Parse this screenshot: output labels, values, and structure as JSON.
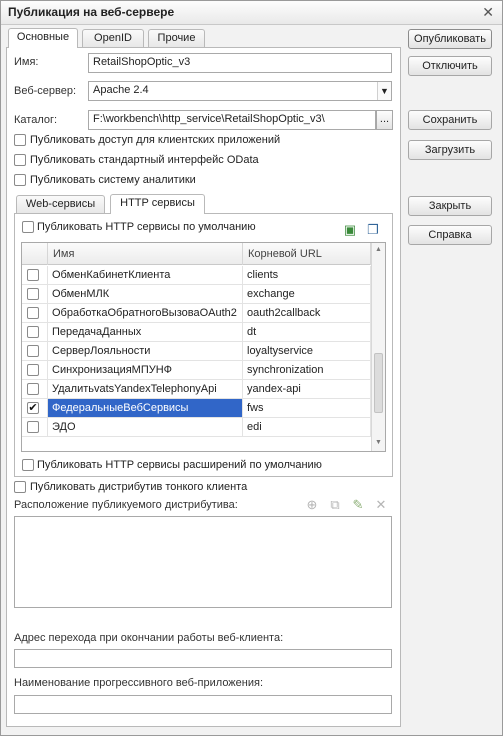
{
  "window": {
    "title": "Публикация на веб-сервере"
  },
  "tabs": [
    {
      "label": "Основные"
    },
    {
      "label": "OpenID"
    },
    {
      "label": "Прочие"
    }
  ],
  "form": {
    "name_label": "Имя:",
    "name_value": "RetailShopOptic_v3",
    "webserver_label": "Веб-сервер:",
    "webserver_value": "Apache 2.4",
    "catalog_label": "Каталог:",
    "catalog_value": "F:\\workbench\\http_service\\RetailShopOptic_v3\\",
    "catalog_button": "...",
    "checks": [
      {
        "label": "Публиковать доступ для клиентских приложений",
        "checked": false
      },
      {
        "label": "Публиковать стандартный интерфейс OData",
        "checked": false
      },
      {
        "label": "Публиковать систему аналитики",
        "checked": false
      }
    ]
  },
  "subtabs": [
    {
      "label": "Web-сервисы"
    },
    {
      "label": "HTTP сервисы"
    }
  ],
  "http": {
    "publish_default_label": "Публиковать HTTP сервисы по умолчанию",
    "col_name": "Имя",
    "col_url": "Корневой URL",
    "rows": [
      {
        "name": "ОбменКабинетКлиента",
        "url": "clients",
        "checked": false
      },
      {
        "name": "ОбменМЛК",
        "url": "exchange",
        "checked": false
      },
      {
        "name": "ОбработкаОбратногоВызоваOAuth2",
        "url": "oauth2callback",
        "checked": false
      },
      {
        "name": "ПередачаДанных",
        "url": "dt",
        "checked": false
      },
      {
        "name": "СерверЛояльности",
        "url": "loyaltyservice",
        "checked": false
      },
      {
        "name": "СинхронизацияМПУНФ",
        "url": "synchronization",
        "checked": false
      },
      {
        "name": "УдалитьvatsYandexTelephonyApi",
        "url": "yandex-api",
        "checked": false
      },
      {
        "name": "ФедеральныеВебСервисы",
        "url": "fws",
        "checked": true,
        "selected": true
      },
      {
        "name": "ЭДО",
        "url": "edi",
        "checked": false
      }
    ],
    "publish_ext_label": "Публиковать HTTP сервисы расширений по умолчанию"
  },
  "thin_client": {
    "publish_label": "Публиковать дистрибутив тонкого клиента",
    "location_label": "Расположение публикуемого дистрибутива:"
  },
  "webclient": {
    "exit_url_label": "Адрес перехода при окончании работы веб-клиента:",
    "exit_url_value": "",
    "pwa_label": "Наименование прогрессивного веб-приложения:",
    "pwa_value": ""
  },
  "buttons": {
    "publish": "Опубликовать",
    "unpublish": "Отключить",
    "save": "Сохранить",
    "load": "Загрузить",
    "close": "Закрыть",
    "help": "Справка"
  },
  "colors": {
    "selection": "#3166c8",
    "window_bg": "#f2f2f2"
  }
}
